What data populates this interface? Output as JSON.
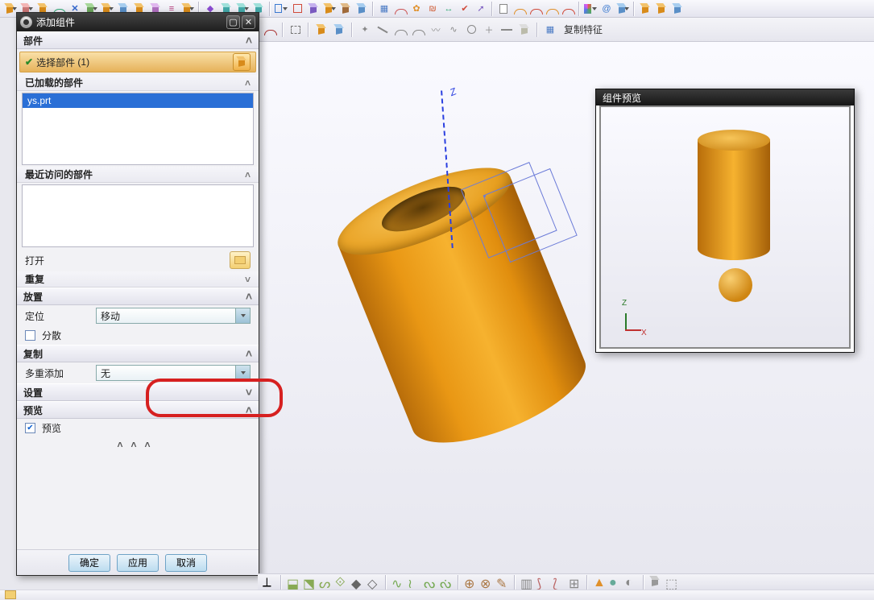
{
  "top_toolbar": {
    "copy_feature_label": "复制特征"
  },
  "dialog": {
    "title": "添加组件",
    "sections": {
      "part": "部件",
      "placement": "放置",
      "copy": "复制",
      "settings": "设置",
      "preview": "预览"
    },
    "select_part": {
      "label": "选择部件",
      "count": "(1)"
    },
    "loaded_parts": {
      "header": "已加载的部件",
      "items": [
        "ys.prt"
      ]
    },
    "recent_parts": {
      "header": "最近访问的部件"
    },
    "open_label": "打开",
    "repeat": {
      "label": "重复"
    },
    "positioning": {
      "label": "定位",
      "value": "移动"
    },
    "scatter_label": "分散",
    "multi_add": {
      "label": "多重添加",
      "value": "无"
    },
    "preview_checkbox": "预览",
    "buttons": {
      "ok": "确定",
      "apply": "应用",
      "cancel": "取消"
    }
  },
  "preview_window": {
    "title": "组件预览",
    "axis_z": "Z",
    "axis_x": "X"
  },
  "viewport": {
    "axis_label": "Z"
  }
}
